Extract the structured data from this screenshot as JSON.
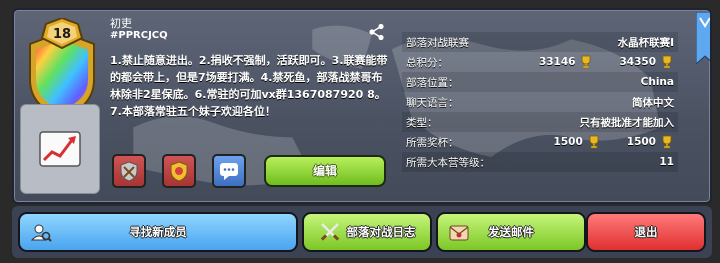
{
  "clan": {
    "name": "初吏",
    "tag": "#PPRCJCQ",
    "level": "18",
    "description": "1.禁止随意进出。2.捐收不强制，活跃即可。3.联赛能带的都会带上，但是7场要打满。4.禁死鱼，部落战禁哥布林除非2星保底。6.常驻的可加vx群1367087920 8。7.本部落常驻五个妹子欢迎各位！"
  },
  "info_rows": [
    {
      "label": "部落对战联赛",
      "value": "水晶杯联赛I"
    },
    {
      "label": "总积分：",
      "value_a": "33146",
      "value_b": "34350"
    },
    {
      "label": "部落位置：",
      "value": "China"
    },
    {
      "label": "聊天语言：",
      "value": "简体中文"
    },
    {
      "label": "类型：",
      "value": "只有被批准才能加入"
    },
    {
      "label": "所需奖杯：",
      "value_a": "1500",
      "value_b": "1500"
    },
    {
      "label": "所需大本营等级：",
      "value": "11"
    }
  ],
  "buttons": {
    "edit": "编辑",
    "find_members": "寻找新成员",
    "war_log": "部落对战日志",
    "send_mail": "发送邮件",
    "leave": "退出"
  },
  "icons": {
    "share": "share-icon",
    "trend": "trend-chart-icon",
    "trophy": "trophy-icon",
    "bookmark": "bookmark-icon",
    "search_person": "search-person-icon",
    "crossed_swords": "crossed-swords-icon",
    "mail": "mail-icon"
  },
  "colors": {
    "panel": "#4a5262",
    "green_button": "#7cc726",
    "blue_button": "#4aa4ee",
    "red_button": "#e03030",
    "trophy_gold": "#e8b820"
  }
}
